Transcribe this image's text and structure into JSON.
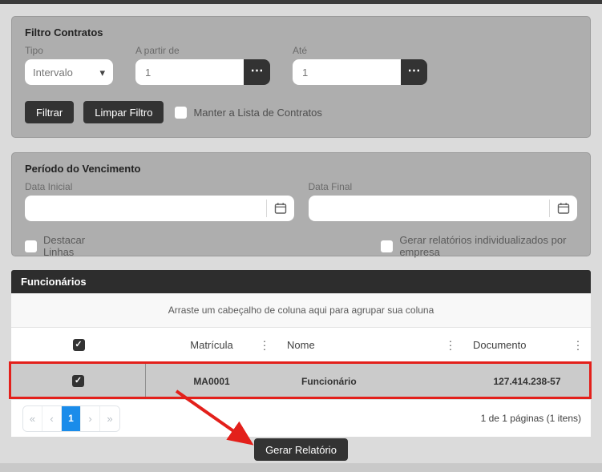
{
  "colors": {
    "page": "#dbdbdb",
    "panel": "#aeaeae",
    "dark": "#333333",
    "table-dark": "#2d2d2d",
    "blue": "#1a8cea",
    "red": "#e3201b"
  },
  "icons": {
    "check": "✓",
    "caret_down": "▾",
    "ellipsis": "⋯",
    "column_menu": "⋮"
  },
  "filtro_contratos": {
    "title": "Filtro Contratos",
    "tipo_label": "Tipo",
    "tipo_value": "Intervalo",
    "a_partir_de_label": "A partir de",
    "a_partir_de_value": "1",
    "ate_label": "Até",
    "ate_value": "1",
    "filtrar_button": "Filtrar",
    "limpar_filtro_button": "Limpar Filtro",
    "manter_lista_label": "Manter a Lista de Contratos"
  },
  "periodo_vencimento": {
    "title": "Período do Vencimento",
    "data_inicial_label": "Data Inicial",
    "data_inicial_value": "",
    "data_final_label": "Data Final",
    "data_final_value": "",
    "destacar_linhas_label": "Destacar Linhas",
    "gerar_individualizados_label": "Gerar relatórios individualizados por empresa"
  },
  "funcionarios": {
    "title": "Funcionários",
    "group_hint": "Arraste um cabeçalho de coluna aqui para agrupar sua coluna",
    "columns": [
      {
        "label": "Matrícula"
      },
      {
        "label": "Nome"
      },
      {
        "label": "Documento"
      }
    ],
    "rows": [
      {
        "selected": true,
        "matricula": "MA0001",
        "nome": "Funcionário",
        "documento": "127.414.238-57"
      }
    ],
    "pagination": {
      "first": "«",
      "prev": "‹",
      "current_page": "1",
      "next": "›",
      "last": "»",
      "summary": "1 de 1 páginas (1 itens)"
    }
  },
  "actions": {
    "gerar_relatorio_button": "Gerar Relatório"
  }
}
